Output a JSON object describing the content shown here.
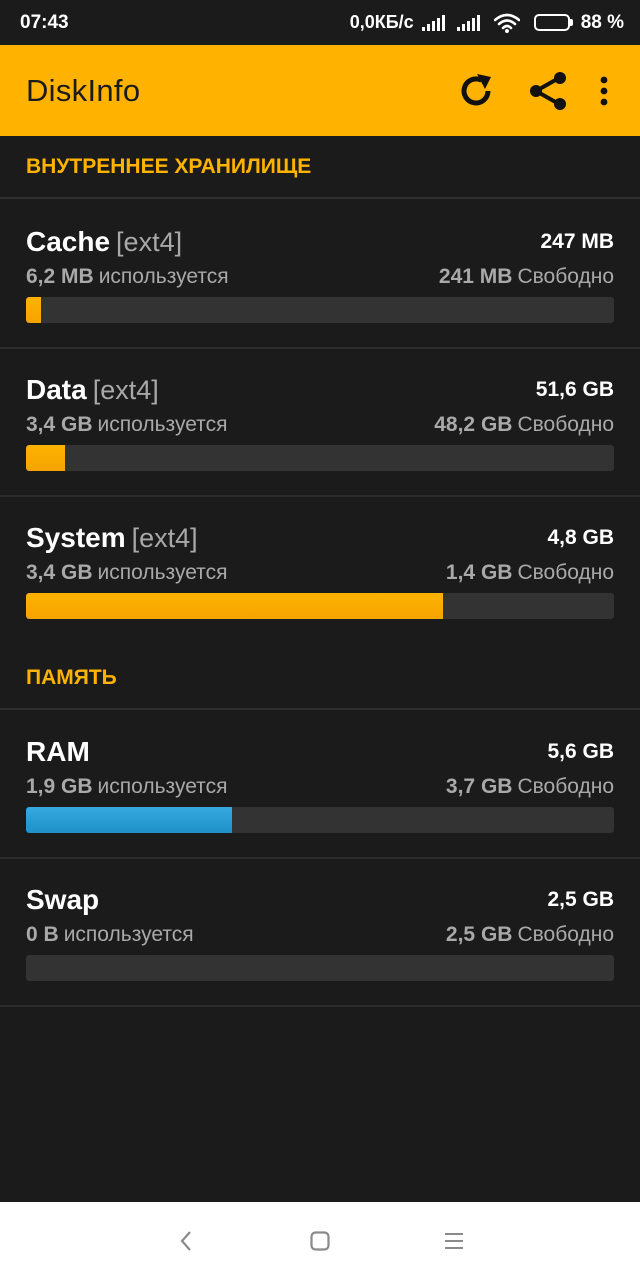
{
  "status_bar": {
    "time": "07:43",
    "speed": "0,0КБ/с",
    "battery": "88 %",
    "battery_level": 0.88
  },
  "app_bar": {
    "title": "DiskInfo",
    "refresh_icon": "refresh-icon",
    "share_icon": "share-icon",
    "menu_icon": "more-vert-icon"
  },
  "sections": [
    {
      "header": "ВНУТРЕННЕЕ ХРАНИЛИЩЕ",
      "items": [
        {
          "name": "Cache",
          "fs": "[ext4]",
          "total": "247 MB",
          "used": "6,2 MB",
          "used_label": "используется",
          "free": "241 MB",
          "free_label": "Свободно",
          "used_fraction": 0.025,
          "bar_color": "#ffb300"
        },
        {
          "name": "Data",
          "fs": "[ext4]",
          "total": "51,6 GB",
          "used": "3,4 GB",
          "used_label": "используется",
          "free": "48,2 GB",
          "free_label": "Свободно",
          "used_fraction": 0.066,
          "bar_color": "#ffb300"
        },
        {
          "name": "System",
          "fs": "[ext4]",
          "total": "4,8 GB",
          "used": "3,4 GB",
          "used_label": "используется",
          "free": "1,4 GB",
          "free_label": "Свободно",
          "used_fraction": 0.71,
          "bar_color": "#ffb300"
        }
      ]
    },
    {
      "header": "ПАМЯТЬ",
      "items": [
        {
          "name": "RAM",
          "total": "5,6 GB",
          "used": "1,9 GB",
          "used_label": "используется",
          "free": "3,7 GB",
          "free_label": "Свободно",
          "used_fraction": 0.35,
          "bar_color": "#29a3dc"
        },
        {
          "name": "Swap",
          "total": "2,5 GB",
          "used": "0 B",
          "used_label": "используется",
          "free": "2,5 GB",
          "free_label": "Свободно",
          "used_fraction": 0.0,
          "bar_color": "#ffb300"
        }
      ]
    }
  ],
  "nav_bar": {
    "back_icon": "back-icon",
    "home_icon": "home-icon",
    "recents_icon": "recents-icon"
  }
}
